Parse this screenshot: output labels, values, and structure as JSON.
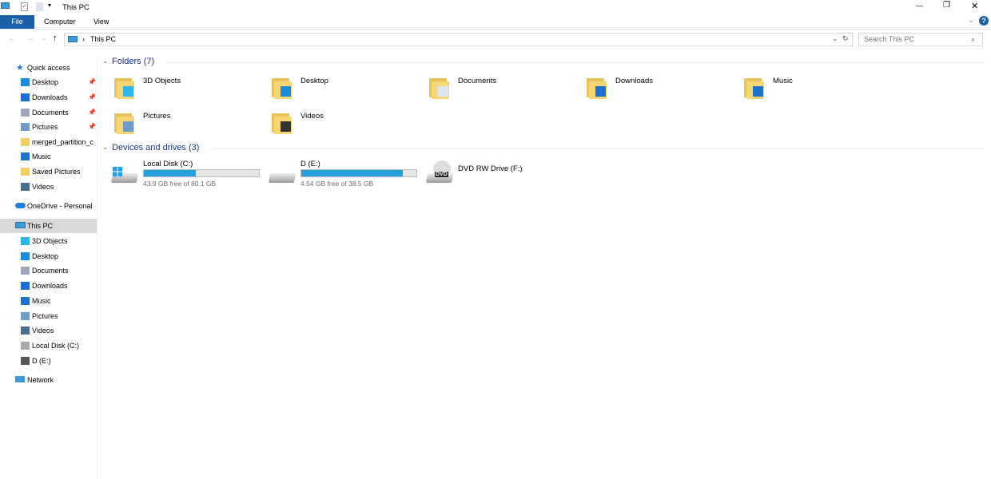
{
  "window": {
    "title": "This PC",
    "minimize": "—",
    "restore": "❐",
    "close": "✕",
    "help": "?",
    "expand_ribbon": "⌄"
  },
  "ribbon": {
    "tabs": [
      "File",
      "Computer",
      "View"
    ]
  },
  "address": {
    "path": "This PC",
    "separator": "›",
    "search_placeholder": "Search This PC"
  },
  "sidebar": {
    "quick_access": "Quick access",
    "qa_items": [
      {
        "label": "Desktop",
        "pinned": true
      },
      {
        "label": "Downloads",
        "pinned": true
      },
      {
        "label": "Documents",
        "pinned": true
      },
      {
        "label": "Pictures",
        "pinned": true
      },
      {
        "label": "merged_partition_c",
        "pinned": false
      },
      {
        "label": "Music",
        "pinned": false
      },
      {
        "label": "Saved Pictures",
        "pinned": false
      },
      {
        "label": "Videos",
        "pinned": false
      }
    ],
    "onedrive": "OneDrive - Personal",
    "this_pc": "This PC",
    "pc_items": [
      "3D Objects",
      "Desktop",
      "Documents",
      "Downloads",
      "Music",
      "Pictures",
      "Videos",
      "Local Disk (C:)",
      "D (E:)"
    ],
    "network": "Network"
  },
  "main": {
    "folders_header": "Folders (7)",
    "folders": [
      "3D Objects",
      "Desktop",
      "Documents",
      "Downloads",
      "Music",
      "Pictures",
      "Videos"
    ],
    "devices_header": "Devices and drives (3)",
    "drives": [
      {
        "label": "Local Disk (C:)",
        "detail": "43.9 GB free of 80.1 GB",
        "used_fraction": 0.45
      },
      {
        "label": "D (E:)",
        "detail": "4.54 GB free of 38.5 GB",
        "used_fraction": 0.88
      },
      {
        "label": "DVD RW Drive (F:)",
        "badge": "DVD"
      }
    ]
  },
  "colors": {
    "accent": "#1a5fa8",
    "bar_fill": "#26a0da",
    "selected": "#d9d9d9",
    "group_header": "#1e3287"
  }
}
